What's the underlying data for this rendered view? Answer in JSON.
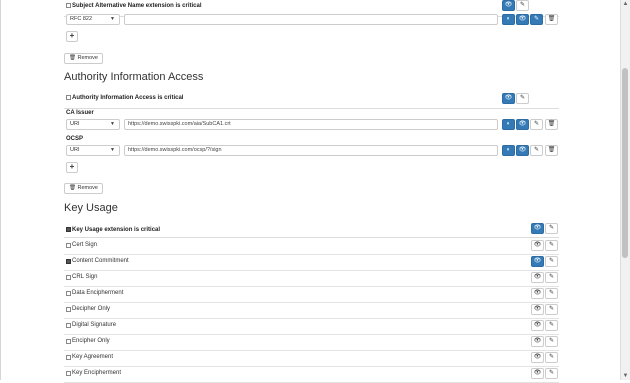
{
  "san": {
    "critical_label": "Subject Alternative Name extension is critical",
    "type_value": "RFC 822",
    "value": "",
    "remove_label": "Remove",
    "plus": "+"
  },
  "aia": {
    "title": "Authority Information Access",
    "critical_label": "Authority Information Access is critical",
    "ca_issuer_label": "CA Issuer",
    "ca_issuer_type": "URI",
    "ca_issuer_value": "https://demo.swisspki.com/aia/SubCA1.crt",
    "ocsp_label": "OCSP",
    "ocsp_type": "URI",
    "ocsp_value": "https://demo.swisspki.com/ocsp/?/sign",
    "plus": "+",
    "remove_label": "Remove"
  },
  "key_usage": {
    "title": "Key Usage",
    "critical_label": "Key Usage extension is critical",
    "items": [
      {
        "label": "Cert Sign",
        "checked": false
      },
      {
        "label": "Content Commitment",
        "checked": true
      },
      {
        "label": "CRL Sign",
        "checked": false
      },
      {
        "label": "Data Encipherment",
        "checked": false
      },
      {
        "label": "Decipher Only",
        "checked": false
      },
      {
        "label": "Digital Signature",
        "checked": false
      },
      {
        "label": "Encipher Only",
        "checked": false
      },
      {
        "label": "Key Agreement",
        "checked": false
      },
      {
        "label": "Key Encipherment",
        "checked": false
      }
    ]
  },
  "icons": {
    "eye": "eye-icon",
    "pencil": "pencil-icon",
    "trash": "trash-icon",
    "toggle": "toggle-icon",
    "caret": "caret-down-icon"
  },
  "colors": {
    "primary": "#337ab7"
  }
}
